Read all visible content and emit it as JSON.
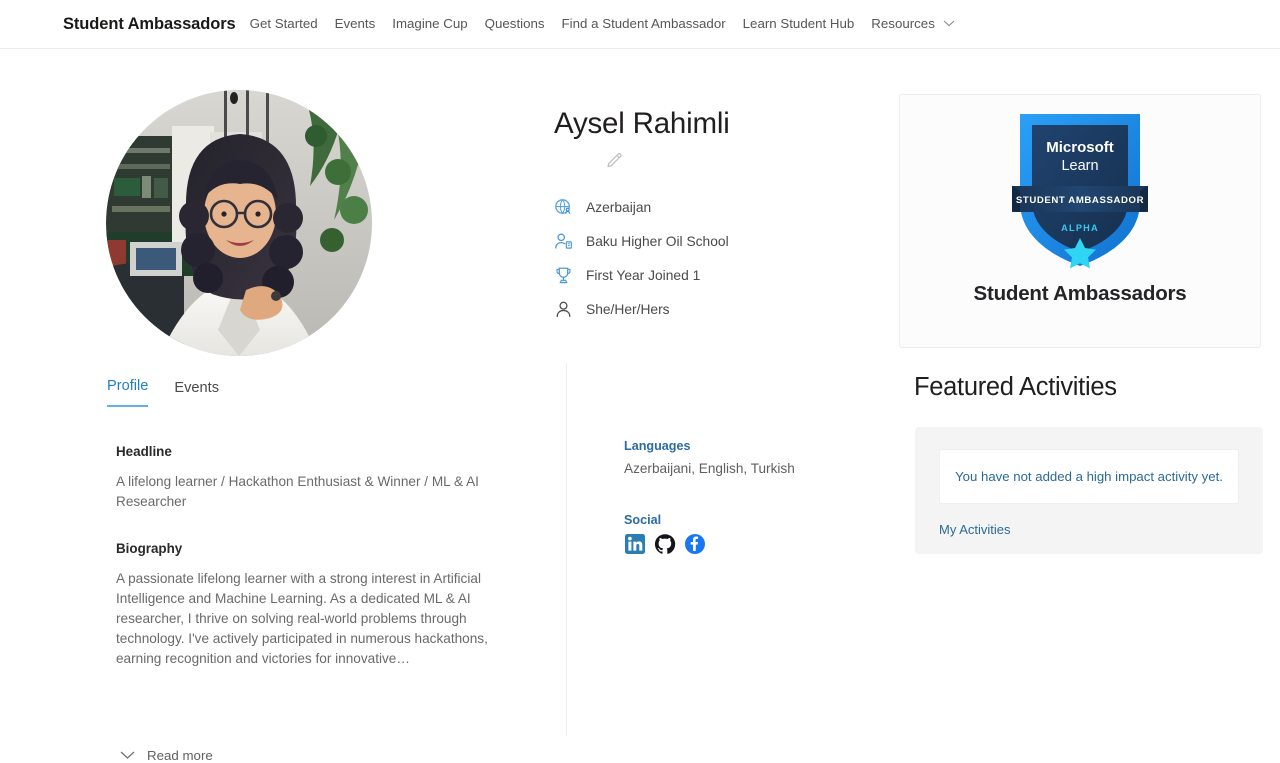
{
  "nav": {
    "brand": "Student Ambassadors",
    "links": [
      {
        "label": "Get Started",
        "icon": null
      },
      {
        "label": "Events",
        "icon": null
      },
      {
        "label": "Imagine Cup",
        "icon": null
      },
      {
        "label": "Questions",
        "icon": null
      },
      {
        "label": "Find a Student Ambassador",
        "icon": null
      },
      {
        "label": "Learn Student Hub",
        "icon": null
      },
      {
        "label": "Resources",
        "icon": "chevron-down-icon"
      }
    ]
  },
  "profile": {
    "avatar_alt": "profile-photo",
    "name": "Aysel Rahimli",
    "edit_icon": "pencil-icon",
    "facts": [
      {
        "icon": "globe-person-icon",
        "label": "Azerbaijan"
      },
      {
        "icon": "person-building-icon",
        "label": "Baku Higher Oil School"
      },
      {
        "icon": "trophy-icon",
        "label": "First Year Joined 1"
      },
      {
        "icon": "person-icon",
        "label": "She/Her/Hers"
      }
    ]
  },
  "tabs": [
    {
      "label": "Profile",
      "active": true
    },
    {
      "label": "Events",
      "active": false
    }
  ],
  "sections": {
    "headline_title": "Headline",
    "headline_body": "A lifelong learner / Hackathon Enthusiast & Winner / ML & AI Researcher",
    "biography_title": "Biography",
    "biography_body": "A passionate lifelong learner with a strong interest in Artificial Intelligence and Machine Learning. As a dedicated ML & AI researcher, I thrive on solving real-world problems through technology. I've actively participated in numerous hackathons, earning recognition and victories for innovative…",
    "read_more": "Read more",
    "read_more_icon": "chevron-down-icon"
  },
  "side": {
    "languages_label": "Languages",
    "languages_value": "Azerbaijani, English, Turkish",
    "social_label": "Social",
    "social_links": [
      {
        "icon": "linkedin-icon",
        "name": "LinkedIn"
      },
      {
        "icon": "github-icon",
        "name": "GitHub"
      },
      {
        "icon": "facebook-icon",
        "name": "Facebook"
      }
    ]
  },
  "badge": {
    "art": "student-ambassador-shield-badge",
    "brand_line1": "Microsoft",
    "brand_line2": "Learn",
    "ribbon": "STUDENT AMBASSADOR",
    "level": "ALPHA",
    "caption": "Student Ambassadors"
  },
  "featured": {
    "title": "Featured Activities",
    "empty_message": "You have not added a high impact activity yet.",
    "link_label": "My Activities"
  },
  "colors": {
    "accent_blue": "#0078d4",
    "tab_active": "#1f7fc4",
    "link_teal": "#2a6a96",
    "badge_outer": "#1b8ef0",
    "badge_inner": "#1c3a63",
    "badge_star": "#28d8f0",
    "body_text": "#6a696d",
    "nav_text": "#57565a"
  }
}
